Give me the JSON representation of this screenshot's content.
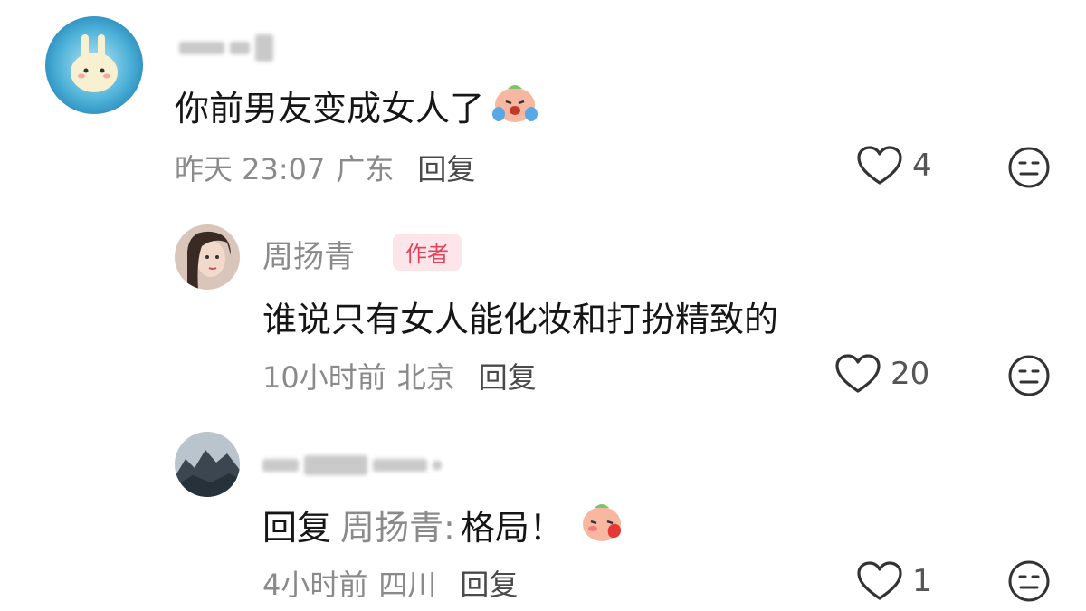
{
  "comments": [
    {
      "username": "",
      "content": "你前男友变成女人了",
      "time": "昨天 23:07",
      "location": "广东",
      "reply_label": "回复",
      "likes": "4"
    },
    {
      "username": "周扬青",
      "badge": "作者",
      "content": "谁说只有女人能化妆和打扮精致的",
      "time": "10小时前",
      "location": "北京",
      "reply_label": "回复",
      "likes": "20"
    },
    {
      "username": "",
      "reply_prefix": "回复",
      "reply_target": "周扬青:",
      "content": "格局！",
      "time": "4小时前",
      "location": "四川",
      "reply_label": "回复",
      "likes": "1"
    }
  ],
  "colors": {
    "text_primary": "#161616",
    "text_secondary": "#8a8a8a",
    "badge_bg": "#fde6ea",
    "badge_text": "#e2445c"
  },
  "icons": {
    "like": "heart-outline-icon",
    "dislike": "neutral-face-icon",
    "emoji_crying": "crying-peach-emoji",
    "emoji_shy": "shy-peach-emoji"
  }
}
